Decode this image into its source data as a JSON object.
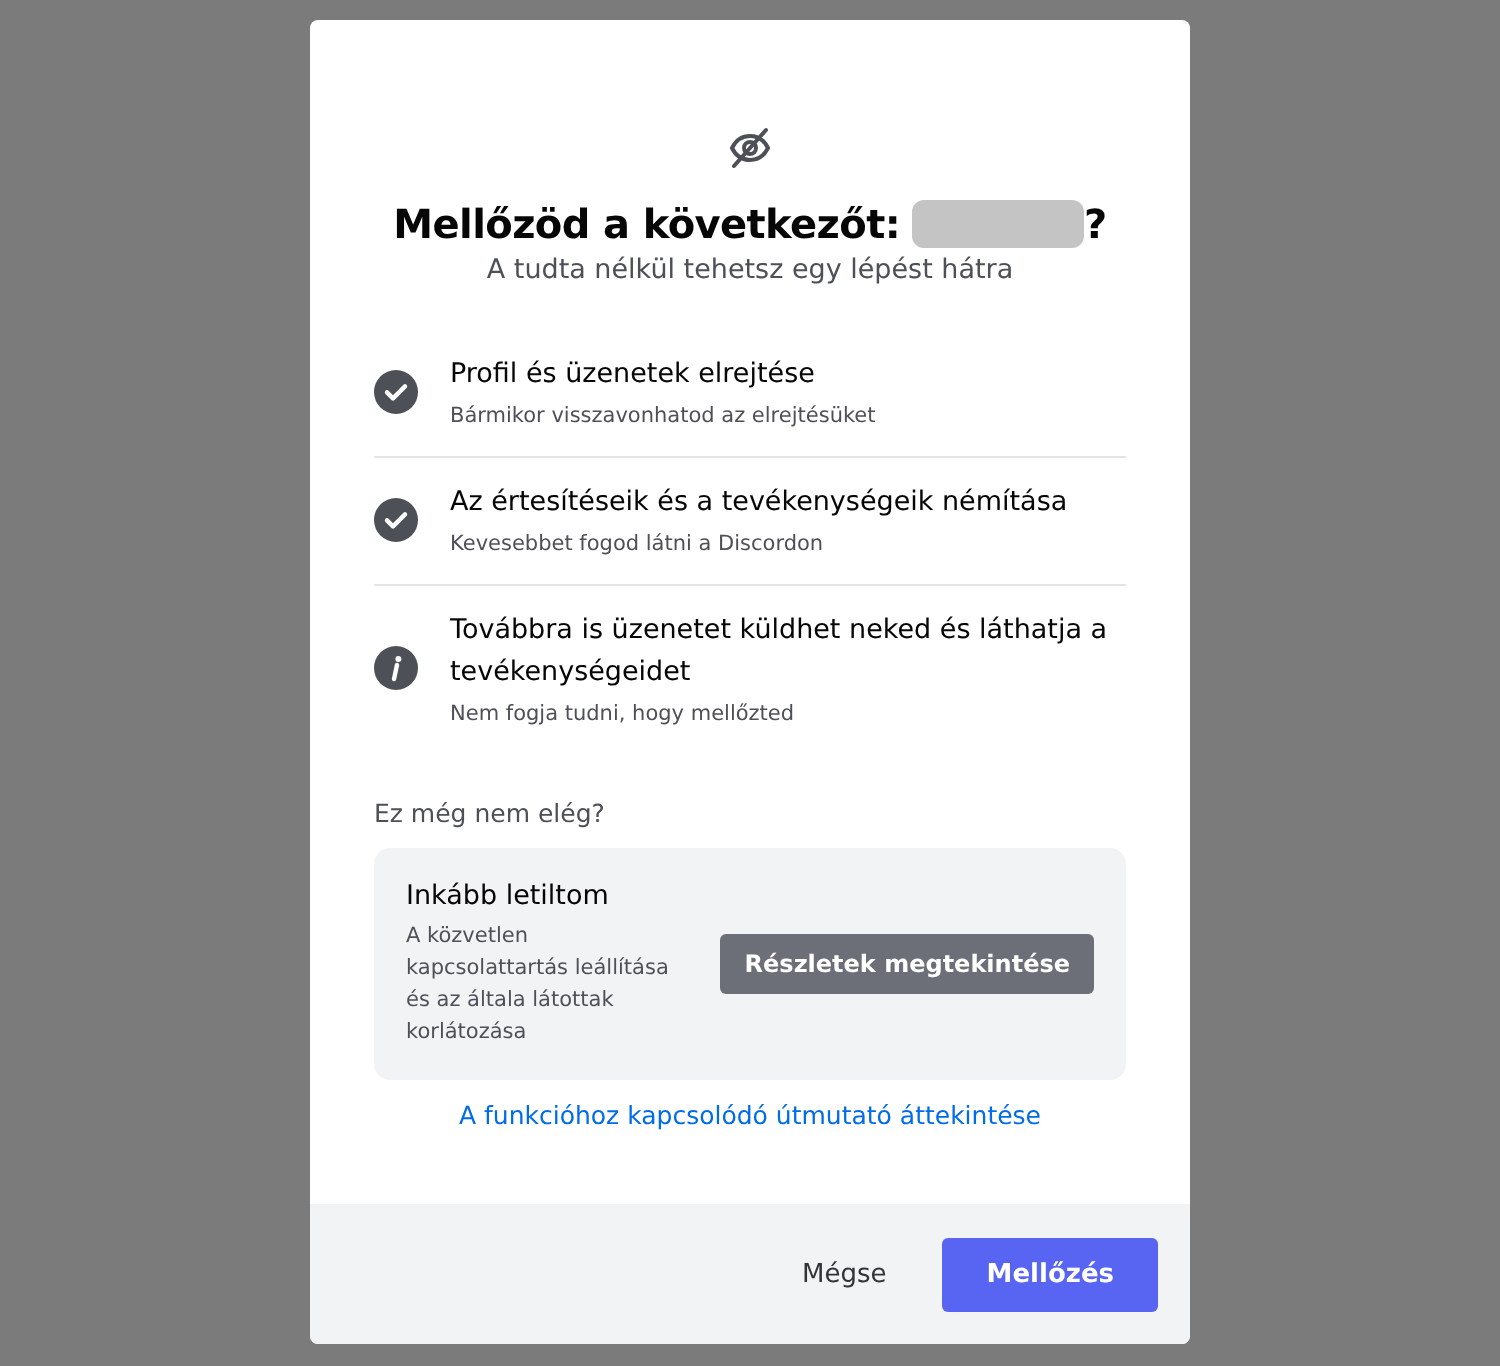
{
  "dialog": {
    "title_before": "Mellőzöd a következőt:",
    "title_after": "?",
    "subtitle": "A tudta nélkül tehetsz egy lépést hátra",
    "items": [
      {
        "kind": "check",
        "title": "Profil és üzenetek elrejtése",
        "note": "Bármikor visszavonhatod az elrejtésüket"
      },
      {
        "kind": "check",
        "title": "Az értesítéseik és a tevékenységeik némítása",
        "note": "Kevesebbet fogod látni a Discordon"
      },
      {
        "kind": "info",
        "title": "Továbbra is üzenetet küldhet neked és láthatja a tevékenységeidet",
        "note": "Nem fogja tudni, hogy mellőzted"
      }
    ],
    "more_heading": "Ez még nem elég?",
    "block": {
      "title": "Inkább letiltom",
      "text": "A közvetlen kapcsolattartás leállítása és az általa látottak korlátozása",
      "button": "Részletek megtekintése"
    },
    "guide_link": "A funkcióhoz kapcsolódó útmutató áttekintése",
    "buttons": {
      "cancel": "Mégse",
      "confirm": "Mellőzés"
    }
  }
}
